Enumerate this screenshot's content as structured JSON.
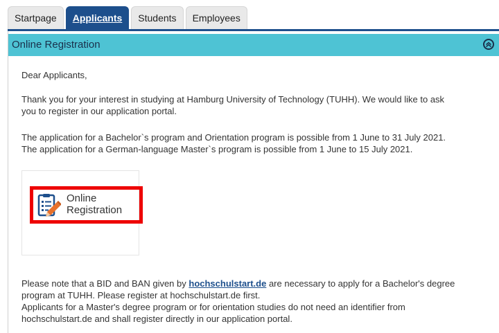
{
  "tabs": [
    {
      "label": "Startpage",
      "active": false
    },
    {
      "label": "Applicants",
      "active": true
    },
    {
      "label": "Students",
      "active": false
    },
    {
      "label": "Employees",
      "active": false
    }
  ],
  "panel": {
    "title": "Online Registration",
    "collapse_icon": "chevron-up-circle-icon"
  },
  "content": {
    "greeting": "Dear Applicants,",
    "thanks_line1": "Thank you for your interest in studying at Hamburg University of Technology (TUHH). We would like to ask",
    "thanks_line2": "you to register in our application portal.",
    "dates_line1": "The application for a Bachelor`s program and Orientation program is possible from 1 June to 31 July 2021.",
    "dates_line2": "The application for a German-language Master`s program is possible from 1 June to 15 July 2021."
  },
  "registration": {
    "label_line1": "Online",
    "label_line2": "Registration",
    "icon": "registration-form-pencil-icon"
  },
  "note": {
    "part1": "Please note that a BID and BAN given by ",
    "link_text": "hochschulstart.de",
    "part2": " are necessary to apply for a Bachelor's degree",
    "line2": "program at TUHH. Please register at hochschulstart.de first.",
    "line3": "Applicants for a Master's degree program or for orientation studies do not need an identifier from",
    "line4": "hochschulstart.de and shall register directly in our application portal."
  },
  "colors": {
    "header_bg": "#4ec3d4",
    "active_tab": "#1d4f8c",
    "highlight_border": "#ee0000"
  }
}
